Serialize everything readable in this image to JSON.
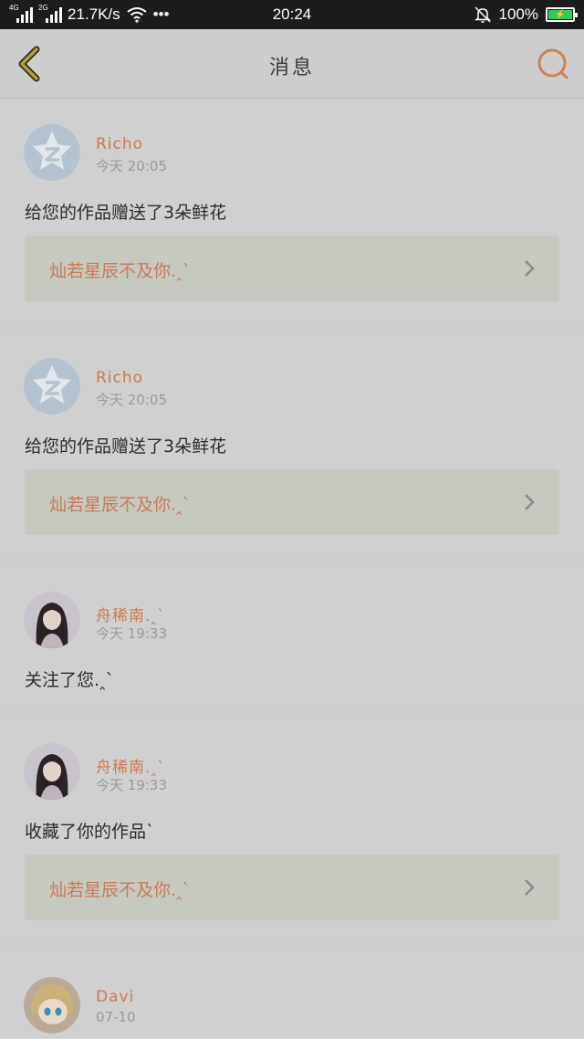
{
  "status_bar": {
    "network1": "4G",
    "network2": "2G",
    "speed": "21.7K/s",
    "more": "•••",
    "time": "20:24",
    "battery": "100%"
  },
  "nav": {
    "title": "消息"
  },
  "colors": {
    "accent": "#c8795a",
    "back_icon": "#b4a22e",
    "battery_green": "#35c85a"
  },
  "messages": [
    {
      "user": "Richo",
      "time": "今天 20:05",
      "text": "给您的作品赠送了3朵鲜花",
      "work": "灿若星辰不及你.‸`",
      "avatar": "qzone-logo"
    },
    {
      "user": "Richo",
      "time": "今天 20:05",
      "text": "给您的作品赠送了3朵鲜花",
      "work": "灿若星辰不及你.‸`",
      "avatar": "qzone-logo"
    },
    {
      "user": "舟稀南.‸`",
      "time": "今天 19:33",
      "text": "关注了您.‸`",
      "avatar": "girl-photo"
    },
    {
      "user": "舟稀南.‸`",
      "time": "今天 19:33",
      "text": "收藏了你的作品`",
      "work": "灿若星辰不及你.‸`",
      "avatar": "girl-photo"
    },
    {
      "user": "Davi",
      "time": "07-10",
      "avatar": "anime-photo"
    }
  ]
}
